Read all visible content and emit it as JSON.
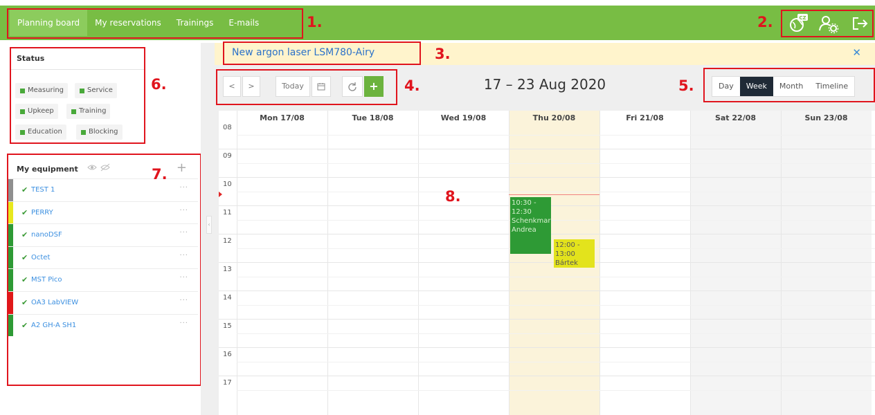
{
  "nav": {
    "items": [
      {
        "label": "Planning board",
        "active": true
      },
      {
        "label": "My reservations",
        "active": false
      },
      {
        "label": "Trainings",
        "active": false
      },
      {
        "label": "E-mails",
        "active": false
      }
    ]
  },
  "top_icons": {
    "language_badge": "CZ",
    "icons": [
      "language-globe-icon",
      "user-settings-icon",
      "logout-icon"
    ]
  },
  "annotations": {
    "n1": "1.",
    "n2": "2.",
    "n3": "3.",
    "n4": "4.",
    "n5": "5.",
    "n6": "6.",
    "n7": "7.",
    "n8": "8."
  },
  "status": {
    "title": "Status",
    "chips": [
      {
        "label": "Measuring",
        "color": "#49a93a"
      },
      {
        "label": "Service",
        "color": "#49a93a"
      },
      {
        "label": "Upkeep",
        "color": "#49a93a"
      },
      {
        "label": "Training",
        "color": "#49a93a"
      },
      {
        "label": "Education",
        "color": "#49a93a"
      },
      {
        "label": "Blocking",
        "color": "#49a93a"
      }
    ]
  },
  "equipment": {
    "title": "My equipment",
    "add_label": "+",
    "items": [
      {
        "name": "TEST 1",
        "color": "#8f8f8f"
      },
      {
        "name": "PERRY",
        "color": "#e8e81e"
      },
      {
        "name": "nanoDSF",
        "color": "#2e9a35"
      },
      {
        "name": "Octet",
        "color": "#2e9a35"
      },
      {
        "name": "MST Pico",
        "color": "#2e9a35"
      },
      {
        "name": "OA3 LabVIEW",
        "color": "#e01818"
      },
      {
        "name": "A2 GH-A SH1",
        "color": "#2e9a35"
      }
    ],
    "check_glyph": "✔",
    "more_glyph": "···"
  },
  "notice": {
    "link_text": "New argon laser LSM780-Airy",
    "close": "✕"
  },
  "toolbar": {
    "prev": "<",
    "next": ">",
    "today": "Today",
    "date_range": "17 – 23 Aug 2020",
    "add": "+",
    "views": [
      {
        "label": "Day",
        "active": false
      },
      {
        "label": "Week",
        "active": true
      },
      {
        "label": "Month",
        "active": false
      },
      {
        "label": "Timeline",
        "active": false
      }
    ]
  },
  "calendar": {
    "days": [
      "Mon 17/08",
      "Tue 18/08",
      "Wed 19/08",
      "Thu 20/08",
      "Fri 21/08",
      "Sat 22/08",
      "Sun 23/08"
    ],
    "today_index": 3,
    "weekend_indices": [
      5,
      6
    ],
    "hours": [
      "08",
      "09",
      "10",
      "11",
      "12",
      "13",
      "14",
      "15",
      "16",
      "17"
    ],
    "events": [
      {
        "day": 3,
        "start": 10.5,
        "end": 12.5,
        "text_lines": [
          "10:30 -",
          "12:30",
          "Schenkmar",
          "Andrea"
        ],
        "color": "green"
      },
      {
        "day": 3,
        "start": 12.0,
        "end": 13.0,
        "text_lines": [
          "12:00 -",
          "13:00",
          "Bártek"
        ],
        "color": "yellow"
      }
    ],
    "now_time": 10.4
  }
}
